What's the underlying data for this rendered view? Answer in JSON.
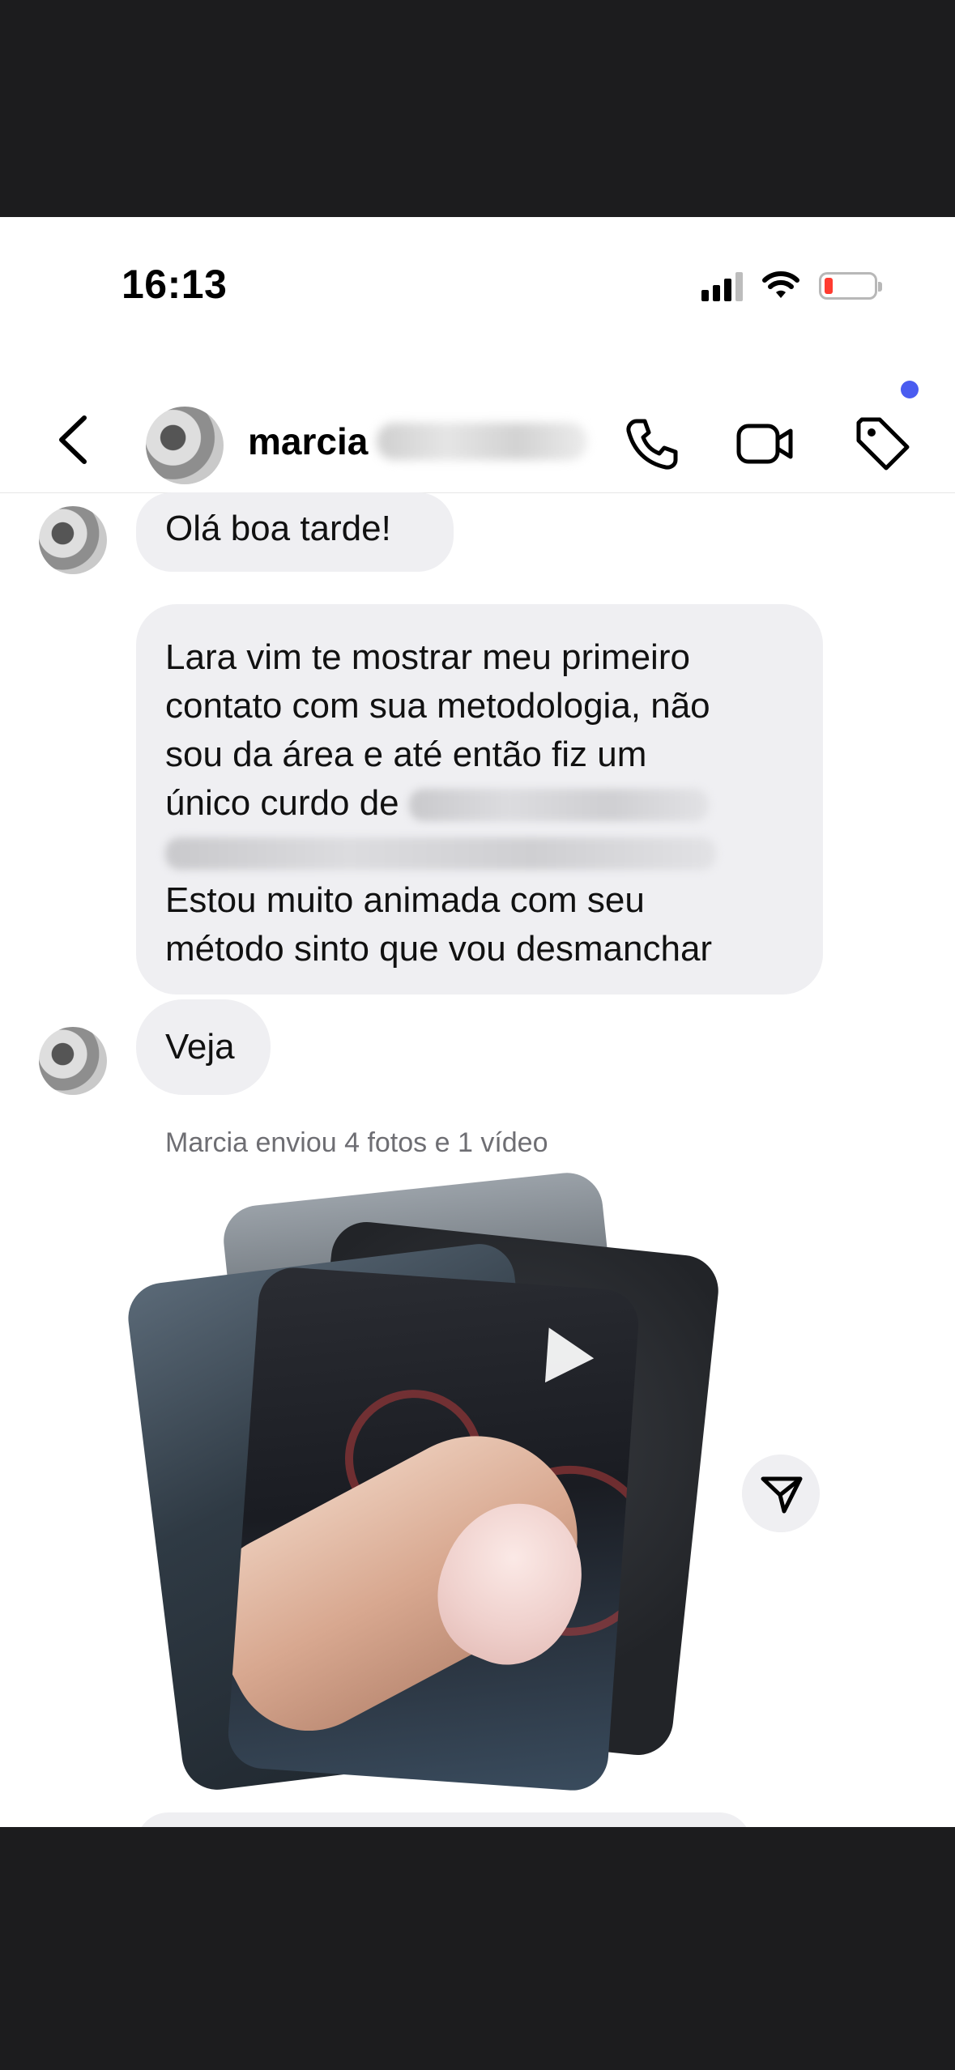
{
  "status_bar": {
    "time": "16:13"
  },
  "header": {
    "contact_name": "marcia"
  },
  "messages": [
    {
      "text": "Olá  boa tarde!"
    },
    {
      "lines": [
        "Lara vim te mostrar meu primeiro",
        "contato com sua metodologia, não",
        "sou da área  e até  então  fiz um",
        "único curdo de",
        "Estou muito animada com seu",
        "método  sinto que vou desmanchar"
      ]
    },
    {
      "text": "Veja"
    }
  ],
  "attachment_note": "Marcia enviou 4 fotos e 1 vídeo",
  "icons": {
    "back": "chevron-left-icon",
    "call": "phone-icon",
    "video": "video-camera-icon",
    "tag": "tag-icon",
    "play": "play-icon",
    "share": "send-icon"
  },
  "colors": {
    "badge": "#4a5cf0",
    "bubble": "#efeff2",
    "battery_low": "#ff3b30"
  }
}
